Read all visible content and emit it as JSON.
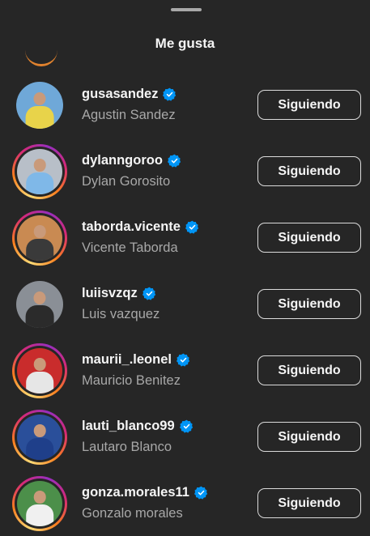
{
  "sheet": {
    "title": "Me gusta"
  },
  "colors": {
    "background": "#262626",
    "primary_text": "#f5f5f5",
    "secondary_text": "#a8a8a8",
    "verified": "#0095f6",
    "button_border": "#dbdbdb"
  },
  "users": [
    {
      "username": "gusasandez",
      "full_name": "Agustin Sandez",
      "button_label": "Siguiendo",
      "verified": true,
      "has_story": false,
      "avatar_bg": "#6fa8d8",
      "avatar_body": "#e8d34a"
    },
    {
      "username": "dylanngoroo",
      "full_name": "Dylan Gorosito",
      "button_label": "Siguiendo",
      "verified": true,
      "has_story": true,
      "avatar_bg": "#b8bfc8",
      "avatar_body": "#7fb8e8"
    },
    {
      "username": "taborda.vicente",
      "full_name": "Vicente Taborda",
      "button_label": "Siguiendo",
      "verified": true,
      "has_story": true,
      "avatar_bg": "#c98a52",
      "avatar_body": "#3a3a3a"
    },
    {
      "username": "luiisvzqz",
      "full_name": "Luis vazquez",
      "button_label": "Siguiendo",
      "verified": true,
      "has_story": false,
      "avatar_bg": "#8a8f96",
      "avatar_body": "#2b2b2b"
    },
    {
      "username": "maurii_.leonel",
      "full_name": "Mauricio Benitez",
      "button_label": "Siguiendo",
      "verified": true,
      "has_story": true,
      "avatar_bg": "#c92c2c",
      "avatar_body": "#e6e6e6"
    },
    {
      "username": "lauti_blanco99",
      "full_name": "Lautaro Blanco",
      "button_label": "Siguiendo",
      "verified": true,
      "has_story": true,
      "avatar_bg": "#2a4f9a",
      "avatar_body": "#1f3f8a"
    },
    {
      "username": "gonza.morales11",
      "full_name": "Gonzalo morales",
      "button_label": "Siguiendo",
      "verified": true,
      "has_story": true,
      "avatar_bg": "#4c8f4a",
      "avatar_body": "#f0f0f0"
    }
  ]
}
